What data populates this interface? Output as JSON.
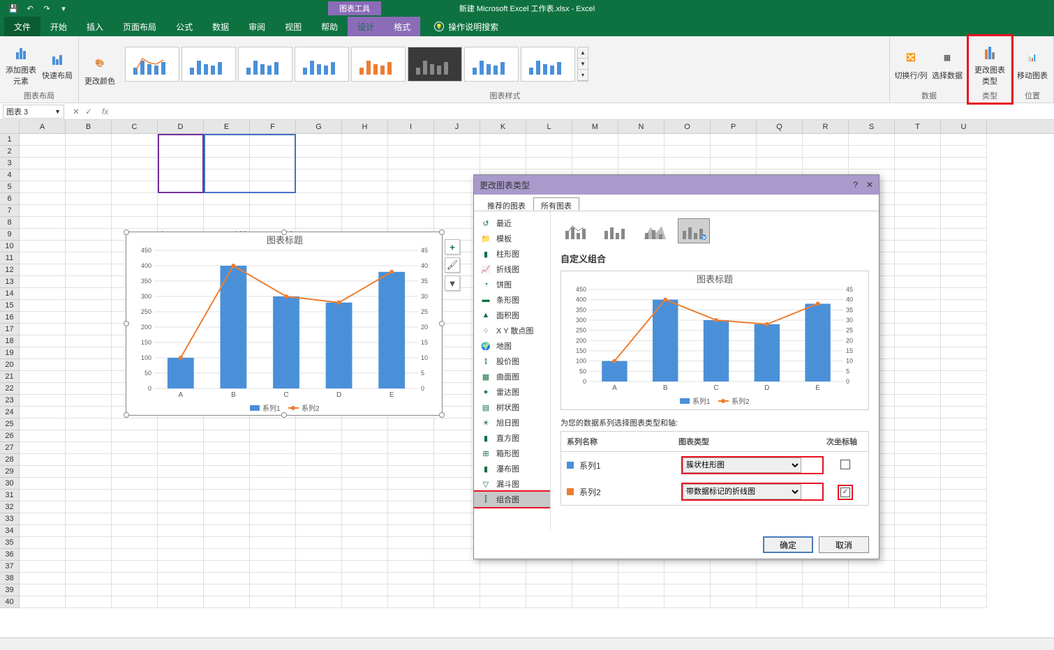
{
  "titlebar": {
    "context_tool": "图表工具",
    "doc_title": "新建 Microsoft Excel 工作表.xlsx  -  Excel"
  },
  "tabs": {
    "file": "文件",
    "home": "开始",
    "insert": "插入",
    "layout": "页面布局",
    "formulas": "公式",
    "data": "数据",
    "review": "审阅",
    "view": "视图",
    "help": "帮助",
    "design": "设计",
    "format": "格式",
    "tellme": "操作说明搜索"
  },
  "ribbon": {
    "add_element": "添加图表元素",
    "quick_layout": "快速布局",
    "change_colors": "更改颜色",
    "layout_group": "图表布局",
    "styles_group": "图表样式",
    "switch_rc": "切换行/列",
    "select_data": "选择数据",
    "data_group": "数据",
    "change_type": "更改图表类型",
    "type_group": "类型",
    "move_chart": "移动图表",
    "location_group": "位置"
  },
  "namebox": "图表 3",
  "columns": [
    "A",
    "B",
    "C",
    "D",
    "E",
    "F",
    "G",
    "H",
    "I",
    "J",
    "K",
    "L",
    "M",
    "N",
    "O",
    "P",
    "Q",
    "R",
    "S",
    "T",
    "U"
  ],
  "data_table": {
    "rows": [
      {
        "label": "A",
        "v1": "100",
        "v2": "10"
      },
      {
        "label": "B",
        "v1": "400",
        "v2": "40"
      },
      {
        "label": "C",
        "v1": "300",
        "v2": "30"
      },
      {
        "label": "D",
        "v1": "280",
        "v2": "28"
      },
      {
        "label": "E",
        "v1": "380",
        "v2": "38"
      }
    ]
  },
  "chart_data": {
    "type": "combo",
    "title": "图表标题",
    "categories": [
      "A",
      "B",
      "C",
      "D",
      "E"
    ],
    "series": [
      {
        "name": "系列1",
        "type": "bar",
        "values": [
          100,
          400,
          300,
          280,
          380
        ],
        "axis": "primary",
        "color": "#4a90d9"
      },
      {
        "name": "系列2",
        "type": "line",
        "values": [
          10,
          40,
          30,
          28,
          38
        ],
        "axis": "secondary",
        "color": "#ed7d31"
      }
    ],
    "ylim": [
      0,
      450
    ],
    "ylim2": [
      0,
      45
    ],
    "yticks": [
      0,
      50,
      100,
      150,
      200,
      250,
      300,
      350,
      400,
      450
    ],
    "yticks2": [
      0,
      5,
      10,
      15,
      20,
      25,
      30,
      35,
      40,
      45
    ],
    "legend": [
      "系列1",
      "系列2"
    ]
  },
  "dialog": {
    "title": "更改图表类型",
    "tab_recommended": "推荐的图表",
    "tab_all": "所有图表",
    "sidebar": {
      "recent": "最近",
      "templates": "模板",
      "column": "柱形图",
      "line": "折线图",
      "pie": "饼图",
      "bar": "条形图",
      "area": "面积图",
      "scatter": "X Y 散点图",
      "map": "地图",
      "stock": "股价图",
      "surface": "曲面图",
      "radar": "雷达图",
      "treemap": "树状图",
      "sunburst": "旭日图",
      "histogram": "直方图",
      "boxwhisker": "箱形图",
      "waterfall": "瀑布图",
      "funnel": "漏斗图",
      "combo": "组合图"
    },
    "custom_combo": "自定义组合",
    "series_prompt": "为您的数据系列选择图表类型和轴:",
    "col_series": "系列名称",
    "col_type": "图表类型",
    "col_secondary": "次坐标轴",
    "series1": "系列1",
    "series2": "系列2",
    "type1": "簇状柱形图",
    "type2": "带数据标记的折线图",
    "ok": "确定",
    "cancel": "取消"
  }
}
